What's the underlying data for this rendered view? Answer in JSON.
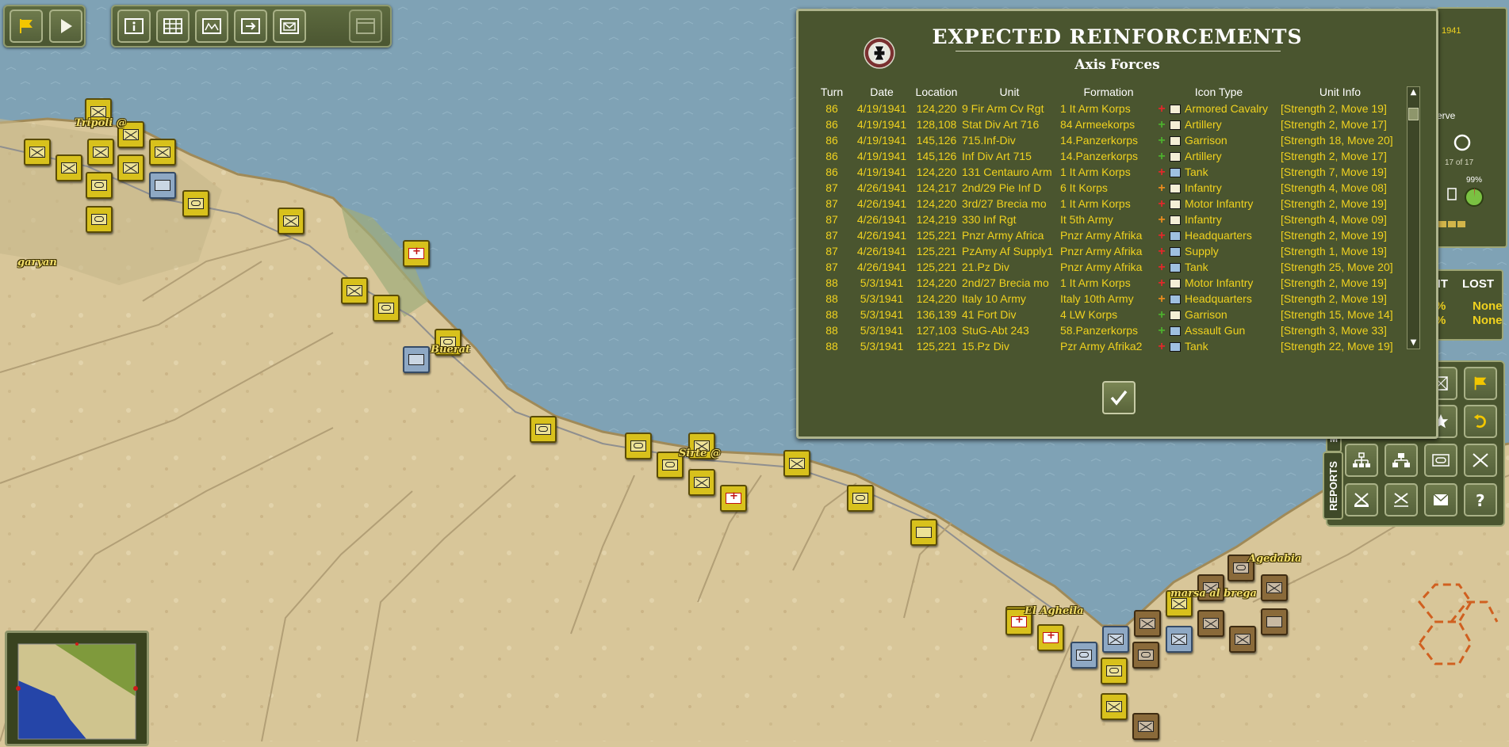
{
  "toolbar_left": {
    "buttons": [
      {
        "name": "flag-button",
        "icon": "flag-icon"
      },
      {
        "name": "end-turn-button",
        "icon": "play-icon"
      }
    ]
  },
  "toolbar_main": {
    "buttons": [
      {
        "name": "info-button",
        "icon": "info-icon"
      },
      {
        "name": "grid-button",
        "icon": "grid-icon"
      },
      {
        "name": "map-view-button",
        "icon": "map-icon"
      },
      {
        "name": "next-unit-button",
        "icon": "next-icon"
      },
      {
        "name": "mail-button",
        "icon": "mail-icon"
      },
      {
        "name": "window-button",
        "icon": "window-icon"
      }
    ]
  },
  "towns": [
    {
      "label": "Tripoli @"
    },
    {
      "label": "garyan"
    },
    {
      "label": "Buerat"
    },
    {
      "label": "Sirte @"
    },
    {
      "label": "El Agheila"
    },
    {
      "label": "marsa al brega"
    },
    {
      "label": "Agedabia"
    }
  ],
  "dialog": {
    "title": "EXPECTED REINFORCEMENTS",
    "subtitle": "Axis Forces",
    "emblem": "iron-cross-icon",
    "columns": [
      "Turn",
      "Date",
      "Location",
      "Unit",
      "Formation",
      "Icon Type",
      "Unit Info"
    ],
    "rows": [
      {
        "turn": "86",
        "date": "4/19/1941",
        "location": "124,220",
        "unit": "9 Fir Arm Cv Rgt",
        "formation": "1 It Arm Korps",
        "status": "red",
        "icon_type": "Armored Cavalry",
        "info": "[Strength 2, Move 19]"
      },
      {
        "turn": "86",
        "date": "4/19/1941",
        "location": "128,108",
        "unit": "Stat Div Art 716",
        "formation": "84 Armeekorps",
        "status": "green",
        "icon_type": "Artillery",
        "info": "[Strength 2, Move 17]"
      },
      {
        "turn": "86",
        "date": "4/19/1941",
        "location": "145,126",
        "unit": "715.Inf-Div",
        "formation": "14.Panzerkorps",
        "status": "green",
        "icon_type": "Garrison",
        "info": "[Strength 18, Move 20]"
      },
      {
        "turn": "86",
        "date": "4/19/1941",
        "location": "145,126",
        "unit": "Inf Div Art 715",
        "formation": "14.Panzerkorps",
        "status": "green",
        "icon_type": "Artillery",
        "info": "[Strength 2, Move 17]"
      },
      {
        "turn": "86",
        "date": "4/19/1941",
        "location": "124,220",
        "unit": "131 Centauro Arm",
        "formation": "1 It Arm Korps",
        "status": "red",
        "icon_type": "Tank",
        "info": "[Strength 7, Move 19]"
      },
      {
        "turn": "87",
        "date": "4/26/1941",
        "location": "124,217",
        "unit": "2nd/29 Pie Inf D",
        "formation": "6 It Korps",
        "status": "orange",
        "icon_type": "Infantry",
        "info": "[Strength 4, Move 08]"
      },
      {
        "turn": "87",
        "date": "4/26/1941",
        "location": "124,220",
        "unit": "3rd/27 Brecia mo",
        "formation": "1 It Arm Korps",
        "status": "red",
        "icon_type": "Motor Infantry",
        "info": "[Strength 2, Move 19]"
      },
      {
        "turn": "87",
        "date": "4/26/1941",
        "location": "124,219",
        "unit": "330 Inf Rgt",
        "formation": "It 5th Army",
        "status": "orange",
        "icon_type": "Infantry",
        "info": "[Strength 4, Move 09]"
      },
      {
        "turn": "87",
        "date": "4/26/1941",
        "location": "125,221",
        "unit": "Pnzr Army Africa",
        "formation": "Pnzr Army Afrika",
        "status": "red",
        "icon_type": "Headquarters",
        "info": "[Strength 2, Move 19]"
      },
      {
        "turn": "87",
        "date": "4/26/1941",
        "location": "125,221",
        "unit": "PzAmy Af Supply1",
        "formation": "Pnzr Army Afrika",
        "status": "red",
        "icon_type": "Supply",
        "info": "[Strength 1, Move 19]"
      },
      {
        "turn": "87",
        "date": "4/26/1941",
        "location": "125,221",
        "unit": "21.Pz Div",
        "formation": "Pnzr Army Afrika",
        "status": "red",
        "icon_type": "Tank",
        "info": "[Strength 25, Move 20]"
      },
      {
        "turn": "88",
        "date": "5/3/1941",
        "location": "124,220",
        "unit": "2nd/27 Brecia mo",
        "formation": "1 It Arm Korps",
        "status": "red",
        "icon_type": "Motor Infantry",
        "info": "[Strength 2, Move 19]"
      },
      {
        "turn": "88",
        "date": "5/3/1941",
        "location": "124,220",
        "unit": "Italy 10 Army",
        "formation": "Italy 10th Army",
        "status": "orange",
        "icon_type": "Headquarters",
        "info": "[Strength 2, Move 19]"
      },
      {
        "turn": "88",
        "date": "5/3/1941",
        "location": "136,139",
        "unit": "41 Fort Div",
        "formation": "4 LW Korps",
        "status": "green",
        "icon_type": "Garrison",
        "info": "[Strength 15, Move 14]"
      },
      {
        "turn": "88",
        "date": "5/3/1941",
        "location": "127,103",
        "unit": "StuG-Abt 243",
        "formation": "58.Panzerkorps",
        "status": "green",
        "icon_type": "Assault Gun",
        "info": "[Strength 3, Move 33]"
      },
      {
        "turn": "88",
        "date": "5/3/1941",
        "location": "125,221",
        "unit": "15.Pz Div",
        "formation": "Pzr Army Afrika2",
        "status": "red",
        "icon_type": "Tank",
        "info": "[Strength 22, Move 19]"
      }
    ],
    "ok_icon": "checkmark-icon"
  },
  "side_panel": {
    "year": "1941",
    "reserve_label": "serve",
    "count": "17 of 17",
    "percent": "99%",
    "loss_headers": [
      "NT",
      "LOST"
    ],
    "loss_values": [
      [
        "%",
        "None"
      ],
      [
        "%",
        "None"
      ]
    ]
  },
  "command_panel": {
    "reports_label": "REPORTS",
    "tab_letter": "M",
    "buttons": [
      "report-icon",
      "flag-icon",
      "star-icon",
      "undo-icon",
      "org-chart-icon",
      "hierarchy-icon",
      "unit-icon",
      "disband-icon",
      "combine-icon",
      "split-icon",
      "mail-icon",
      "help-icon"
    ]
  },
  "colors": {
    "sea": "#7fa4b8",
    "desert": "#d9c79a",
    "panel": "#4a552f",
    "text_yellow": "#f0d21f",
    "annotation_blue": "#1a27c8"
  }
}
